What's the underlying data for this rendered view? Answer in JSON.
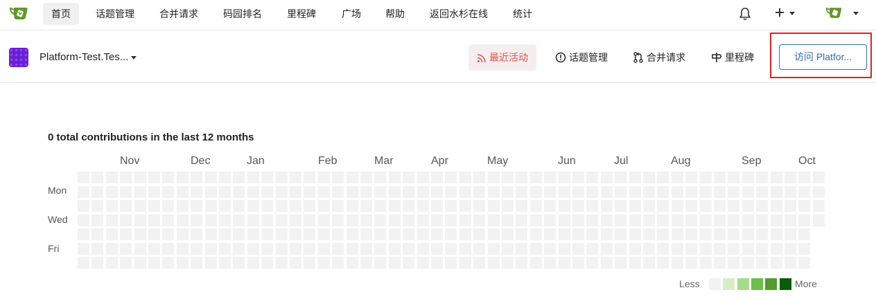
{
  "topnav": {
    "items": [
      "首页",
      "话题管理",
      "合并请求",
      "码园排名",
      "里程碑",
      "广场",
      "帮助",
      "返回水杉在线",
      "统计"
    ],
    "active": 0
  },
  "repo": {
    "name": "Platform-Test.Tes...",
    "tabs": [
      {
        "label": "最近活动",
        "icon": "rss-icon"
      },
      {
        "label": "话题管理",
        "icon": "issue-icon"
      },
      {
        "label": "合并请求",
        "icon": "pull-request-icon"
      },
      {
        "label": "里程碑",
        "icon": "milestone-icon"
      }
    ],
    "active_tab": 0,
    "visit_label": "访问 Platfor..."
  },
  "contributions": {
    "title": "0 total contributions in the last 12 months",
    "months": [
      "Nov",
      "Dec",
      "Jan",
      "Feb",
      "Mar",
      "Apr",
      "May",
      "Jun",
      "Jul",
      "Aug",
      "Sep",
      "Oct"
    ],
    "day_labels": [
      "Mon",
      "Wed",
      "Fri"
    ],
    "weeks": 53,
    "last_week_days": 4,
    "legend_less": "Less",
    "legend_more": "More",
    "legend_colors": [
      "#f2f2f2",
      "#d6eec5",
      "#a4dc8c",
      "#6cc04a",
      "#559b2f",
      "#0a5c0a"
    ]
  },
  "colors": {
    "accent": "#2f6dae",
    "active_tab_text": "#d9534f",
    "highlight": "#e02020",
    "logo": "#609926"
  }
}
